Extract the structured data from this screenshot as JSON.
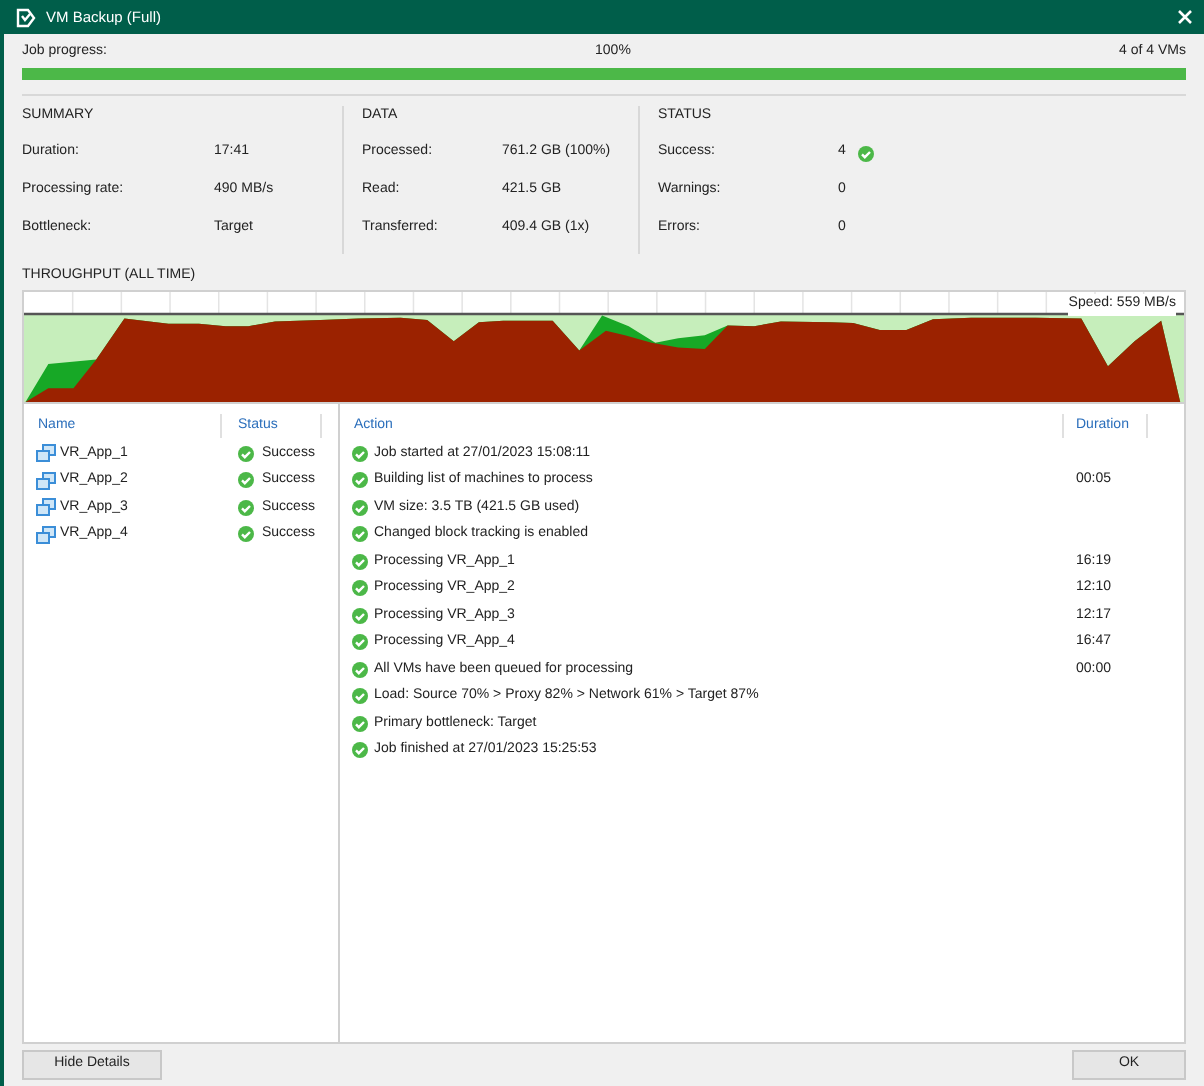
{
  "window": {
    "title": "VM Backup (Full)"
  },
  "progress": {
    "label": "Job progress:",
    "percent": "100%",
    "count": "4 of 4 VMs",
    "level": 1
  },
  "sections": [
    {
      "title": "SUMMARY",
      "rows": [
        {
          "label": "Duration:",
          "value": "17:41"
        },
        {
          "label": "Processing rate:",
          "value": "490 MB/s"
        },
        {
          "label": "Bottleneck:",
          "value": "Target"
        }
      ]
    },
    {
      "title": "DATA",
      "rows": [
        {
          "label": "Processed:",
          "value": "761.2 GB (100%)"
        },
        {
          "label": "Read:",
          "value": "421.5 GB"
        },
        {
          "label": "Transferred:",
          "value": "409.4 GB (1x)"
        }
      ]
    },
    {
      "title": "STATUS",
      "rows": [
        {
          "label": "Success:",
          "value": "4",
          "kind": "success"
        },
        {
          "label": "Warnings:",
          "value": "0",
          "kind": "plain"
        },
        {
          "label": "Errors:",
          "value": "0",
          "kind": "plain"
        }
      ]
    }
  ],
  "throughput": {
    "title": "THROUGHPUT (ALL TIME)",
    "speed": "Speed: 559 MB/s"
  },
  "vm_table": {
    "columns": [
      "Name",
      "Status"
    ],
    "rows": [
      {
        "name": "VR_App_1",
        "status": "Success"
      },
      {
        "name": "VR_App_2",
        "status": "Success"
      },
      {
        "name": "VR_App_3",
        "status": "Success"
      },
      {
        "name": "VR_App_4",
        "status": "Success"
      }
    ]
  },
  "log": {
    "columns": [
      "Action",
      "Duration"
    ],
    "rows": [
      {
        "action": "Job started at 27/01/2023 15:08:11"
      },
      {
        "action": "Building list of machines to process",
        "duration": "00:05"
      },
      {
        "action": "VM size: 3.5 TB (421.5 GB used)"
      },
      {
        "action": "Changed block tracking is enabled"
      },
      {
        "action": "Processing VR_App_1",
        "duration": "16:19"
      },
      {
        "action": "Processing VR_App_2",
        "duration": "12:10"
      },
      {
        "action": "Processing VR_App_3",
        "duration": "12:17"
      },
      {
        "action": "Processing VR_App_4",
        "duration": "16:47"
      },
      {
        "action": "All VMs have been queued for processing",
        "duration": "00:00"
      },
      {
        "action": "Load: Source 70% > Proxy 82% > Network 61% > Target 87%"
      },
      {
        "action": "Primary bottleneck: Target"
      },
      {
        "action": "Job finished at 27/01/2023 15:25:53"
      }
    ]
  },
  "buttons": [
    {
      "label": "Hide Details"
    },
    {
      "label": "OK"
    }
  ]
}
